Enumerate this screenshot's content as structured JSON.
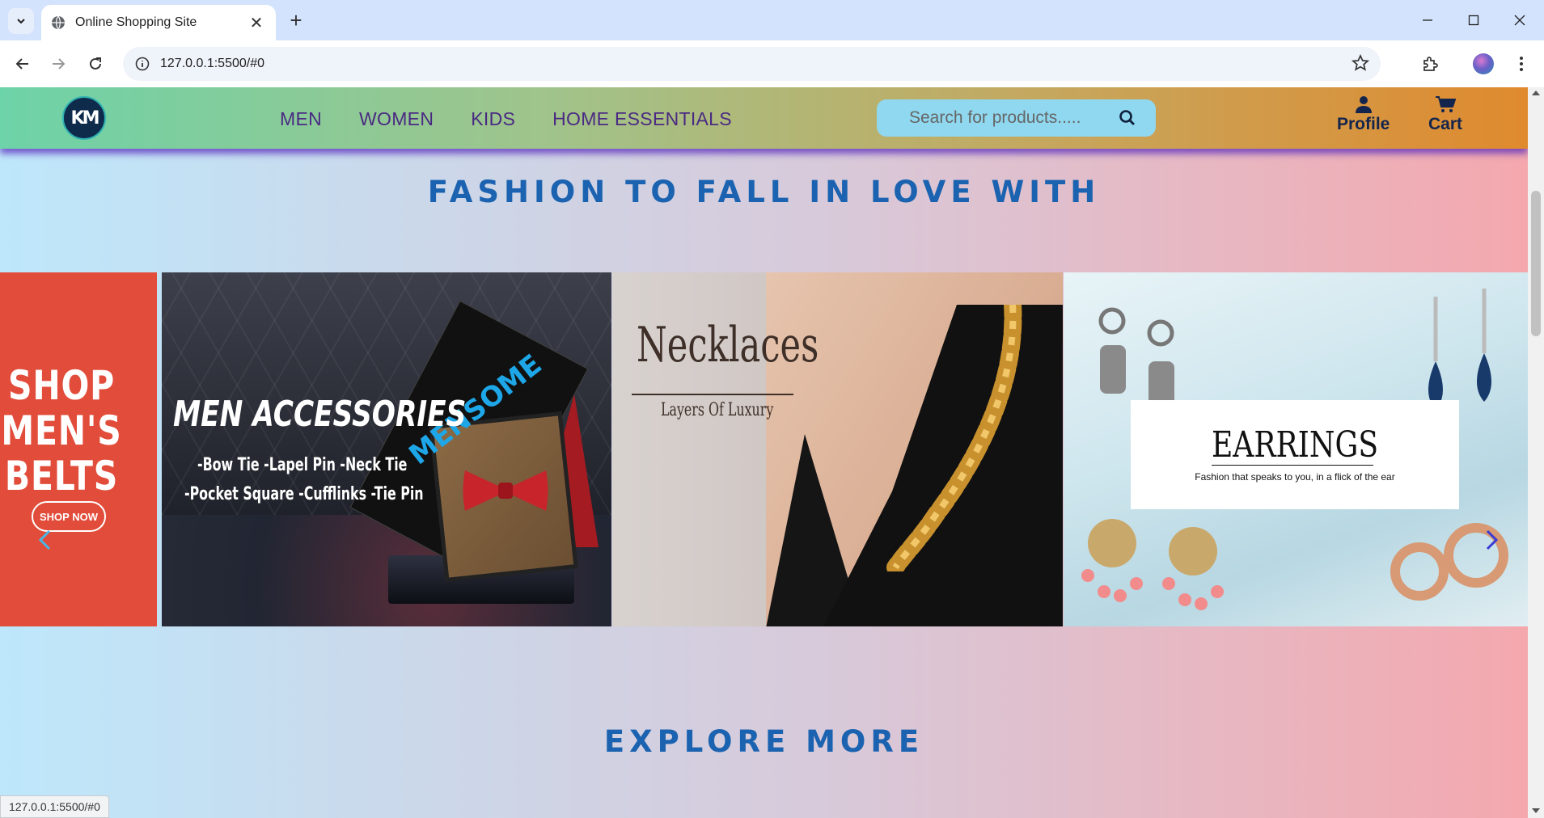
{
  "browser": {
    "tab_title": "Online Shopping Site",
    "url": "127.0.0.1:5500/#0",
    "status_url": "127.0.0.1:5500/#0"
  },
  "site": {
    "logo_text": "KM",
    "nav": [
      "MEN",
      "WOMEN",
      "KIDS",
      "HOME ESSENTIALS"
    ],
    "search_placeholder": "Search for products.....",
    "profile_label": "Profile",
    "cart_label": "Cart"
  },
  "hero": {
    "title": "FASHION TO FALL IN LOVE WITH",
    "slides": {
      "belts": {
        "line1": "SHOP MEN'S",
        "line2": "BELTS",
        "button": "SHOP NOW"
      },
      "men": {
        "heading": "MEN ACCESSORIES",
        "sub1": "-Bow Tie -Lapel Pin -Neck Tie",
        "sub2": "-Pocket Square -Cufflinks -Tie Pin",
        "brand": "MENSOME"
      },
      "necklaces": {
        "title": "Necklaces",
        "subtitle": "Layers Of Luxury"
      },
      "earrings": {
        "title": "EARRINGS",
        "subtitle": "Fashion that speaks to you, in a flick of the ear"
      }
    }
  },
  "explore": {
    "title": "EXPLORE MORE"
  },
  "colors": {
    "accent": "#1b63b0",
    "nav_text": "#4a2a82",
    "header_shadow": "#5828be"
  }
}
